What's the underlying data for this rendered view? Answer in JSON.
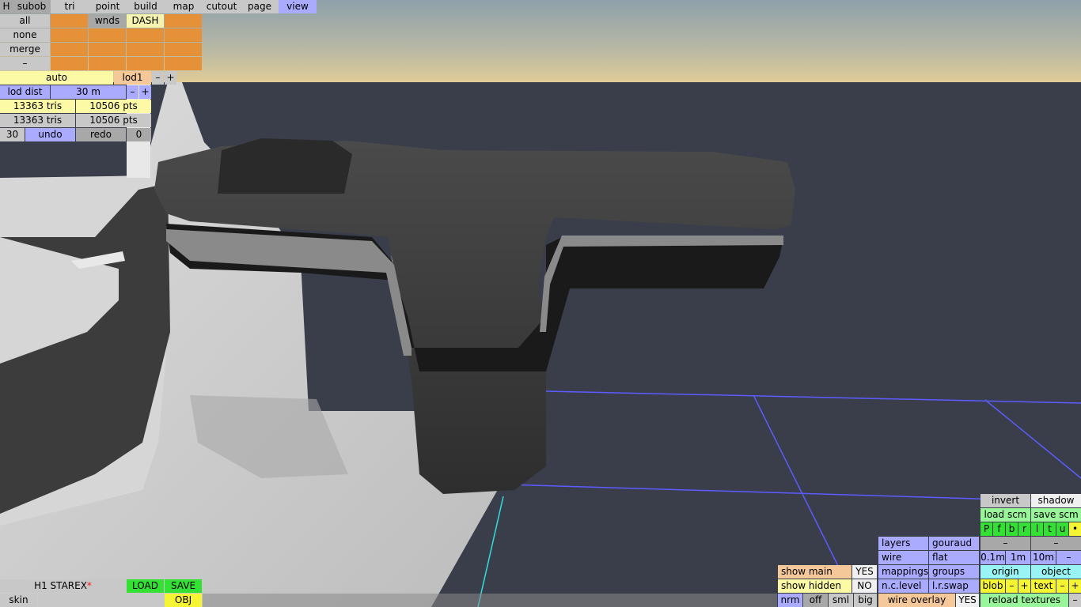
{
  "menu": {
    "h": "H",
    "subob": "subob",
    "tri": "tri",
    "point": "point",
    "build": "build",
    "map": "map",
    "cutout": "cutout",
    "page": "page",
    "view": "view"
  },
  "sel": {
    "all": "all",
    "none": "none",
    "merge": "merge",
    "minus": "–",
    "wnds": "wnds",
    "dash": "DASH"
  },
  "lod": {
    "auto": "auto",
    "lod1": "lod1",
    "minus": "–",
    "plus": "+",
    "dist_label": "lod dist",
    "dist_value": "30 m",
    "dist_minus": "–",
    "dist_plus": "+"
  },
  "stats": {
    "tris1": "13363 tris",
    "pts1": "10506 pts",
    "tris2": "13363 tris",
    "pts2": "10506 pts"
  },
  "history": {
    "undo_count": "30",
    "undo": "undo",
    "redo": "redo",
    "redo_count": "0"
  },
  "file": {
    "name": "H1 STAREX",
    "modified_mark": "*",
    "load": "LOAD",
    "save": "SAVE",
    "skin": "skin",
    "skin_value": "",
    "obj": "OBJ"
  },
  "show": {
    "main_label": "show main",
    "main_value": "YES",
    "hidden_label": "show hidden",
    "hidden_value": "NO",
    "nrm": "nrm",
    "off": "off",
    "sml": "sml",
    "big": "big"
  },
  "render": {
    "layers": "layers",
    "gouraud": "gouraud",
    "wire": "wire",
    "flat": "flat",
    "mappings": "mappings",
    "groups": "groups",
    "nclevel": "n.c.level",
    "lrswap": "l.r.swap",
    "wire_overlay": "wire overlay",
    "wire_overlay_value": "YES"
  },
  "rightpanel": {
    "invert": "invert",
    "shadow": "shadow",
    "load_scm": "load scm",
    "save_scm": "save scm",
    "flags": [
      "P",
      "f",
      "b",
      "r",
      "l",
      "t",
      "u"
    ],
    "dot": "•",
    "dash1": "–",
    "dash2": "–",
    "grid1": "0.1m",
    "grid2": "1m",
    "grid3": "10m",
    "grid_minus": "–",
    "origin": "origin",
    "object": "object",
    "blob": "blob",
    "blob_minus": "–",
    "blob_plus": "+",
    "text": "text",
    "text_minus": "–",
    "text_plus": "+",
    "reload": "reload textures",
    "reload_minus": "–"
  },
  "colors": {
    "sky_top": "#8f9fa8",
    "sky_bottom": "#d8c89a",
    "ground": "#3a3d4a",
    "grid_line": "#5a5aff",
    "axis_line": "#33dddd"
  }
}
